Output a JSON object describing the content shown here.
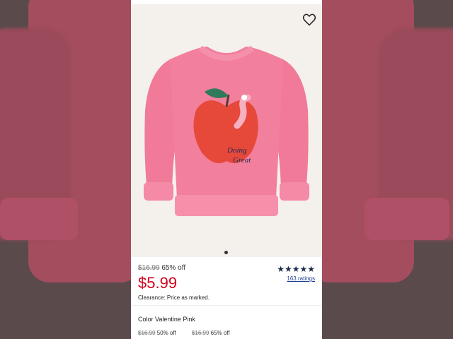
{
  "product": {
    "original_price": "$16.99",
    "discount": "65% off",
    "sale_price": "$5.99",
    "clearance_note": "Clearance: Price as marked.",
    "rating_stars": "★★★★★",
    "rating_value": 4.5,
    "ratings_count": "163 ratings",
    "color_label": "Color Valentine Pink",
    "graphic_text": "Doing Great"
  },
  "variants": [
    {
      "original_price": "$16.99",
      "discount": "50% off"
    },
    {
      "original_price": "$16.99",
      "discount": "65% off"
    }
  ],
  "colors": {
    "sale_red": "#d0021b",
    "sweater_pink": "#f07a98",
    "apple_red": "#e6493a"
  },
  "icons": {
    "favorite": "heart-icon",
    "carousel": "carousel-dot-icon"
  }
}
